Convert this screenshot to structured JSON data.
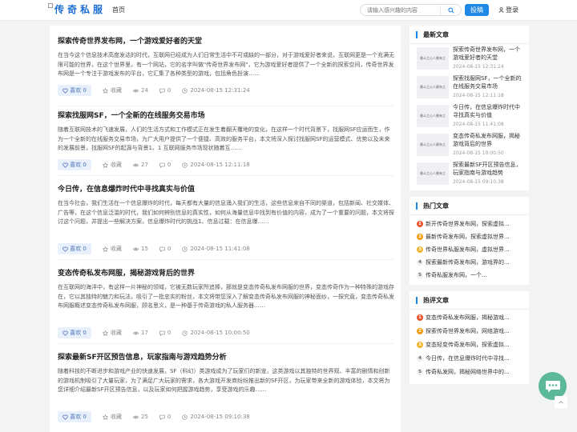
{
  "header": {
    "logo": "传奇私服",
    "nav_home": "首页",
    "search_placeholder": "请输入感兴趣的内容",
    "contribute": "投稿",
    "login": "登录"
  },
  "articles": [
    {
      "title": "探索传奇世界发布网，一个游戏爱好者的天堂",
      "summary": "在当今这个信息技术高度发达的时代，互联网已经成为人们日常生活中不可或缺的一部分，对于游戏爱好者来说，互联网更是一个充满无限可能的世界，在这个世界里，有一个网站，它的名字叫做\"传奇世界发布网\"，它为游戏爱好者提供了一个全新的探索空间，传奇世界发布网是一个专注于游戏发布的平台，它汇集了各种类型的游戏，包括角色扮演……",
      "like": "喜欢 0",
      "fav": "收藏",
      "views": "24",
      "comments": "0",
      "date": "2024-08-15 12:31:24"
    },
    {
      "title": "探索找服网SF，一个全新的在线服务交易市场",
      "summary": "随着互联网技术的飞速发展，人们的生活方式和工作模式正在发生着翻天覆地的变化，在这样一个时代背景下，找服网SF应运而生，作为一个全新的在线服务交易市场，为广大用户提供了一个便捷、高效的服务平台，本文将深入探讨找服网SF的运营模式、优势以及未来的发展前景，找服网SF的起源与背景1、1 互联网服务市场现状随着互……",
      "like": "喜欢 0",
      "fav": "收藏",
      "views": "27",
      "comments": "0",
      "date": "2024-08-15 12:11:18"
    },
    {
      "title": "今日传，在信息爆炸时代中寻找真实与价值",
      "summary": "在当今社会，我们生活在一个信息爆炸的时代，每天都有大量的信息涌入我们的生活，这些信息来自不同的渠道，包括新闻、社交媒体、广告等，在这个信息泛滥的时代，我们如何辨别信息的真实性，如何从海量信息中找到有价值的内容，成为了一个重要的问题，本文将探讨这个问题，并提出一些解决方案，信息爆炸时代的挑战1、信息过载：在信息爆……",
      "like": "喜欢 0",
      "fav": "收藏",
      "views": "15",
      "comments": "0",
      "date": "2024-08-15 11:41:08"
    },
    {
      "title": "变态传奇私发布网服，揭秘游戏背后的世界",
      "summary": "在互联网的海洋中，有这样一片神秘的领域，它被无数玩家所追捧，那就是变态传奇私发布网服的世界，变态传奇作为一种特殊的游戏存在，它以其独特的魅力和玩法，吸引了一批忠实的粉丝，本文将带您深入了解变态传奇私发布网服的神秘面纱，一探究竟，变态传奇私发布网服概述变态传奇私发布网服，顾名思义，是一种基于传奇游戏的私人服务器……",
      "like": "喜欢 0",
      "fav": "收藏",
      "views": "17",
      "comments": "0",
      "date": "2024-08-15 10:00:50"
    },
    {
      "title": "探索最新SF开区预告信息，玩家指南与游戏趋势分析",
      "summary": "随着科技的不断进步和游戏产业的快速发展，SF（科幻）类游戏成为了玩家们的新宠，这类游戏以其独特的世界观、丰富的剧情和创新的游戏机制吸引了大量玩家，为了满足广大玩家的需求，各大游戏开发商纷纷推出新的SF开区，为玩家带来全新的游戏体验，本文将为您详细介绍最新SF开区预告信息，以及玩家如何把握游戏趋势，享受游戏的乐趣……",
      "like": "喜欢 0",
      "fav": "收藏",
      "views": "25",
      "comments": "0",
      "date": "2024-08-15 09:10:38"
    }
  ],
  "sidebar": {
    "recent_title": "最新文章",
    "thumb_text": "最斗之心人最有之",
    "recent": [
      {
        "title": "探索传奇世界发布网，一个游戏爱好者的天堂",
        "date": "2024-08-15 12:31:24"
      },
      {
        "title": "探索找服网SF，一个全新的在线服务交易市场",
        "date": "2024-08-15 12:11:18"
      },
      {
        "title": "今日传，在信息爆炸时代中寻找真实与价值",
        "date": "2024-08-15 11:41:08"
      },
      {
        "title": "变态传奇私发布网服，揭秘游戏背后的世界",
        "date": "2024-08-15 10:00:50"
      },
      {
        "title": "探索最新SF开区预告信息，玩家指南与游戏趋势",
        "date": "2024-08-15 09:10:38"
      }
    ],
    "hot_title": "热门文章",
    "hot": [
      {
        "num": "1",
        "text": "新开传奇世界发布网，探索虚拟..."
      },
      {
        "num": "2",
        "text": "最新传奇发布网，探索虚拟世界..."
      },
      {
        "num": "3",
        "text": "传奇世界私服发布网，虚拟世界..."
      },
      {
        "num": "4",
        "text": "探索最新传奇发布网，游戏界的..."
      },
      {
        "num": "5",
        "text": "传奇私服发布网，一个..."
      }
    ],
    "review_title": "热评文章",
    "reviews": [
      {
        "num": "1",
        "text": "变态传奇私发布网服，揭秘游戏..."
      },
      {
        "num": "2",
        "text": "探索传奇世界发布网，网络游戏..."
      },
      {
        "num": "3",
        "text": "变态轻变传奇发布网，探索虚拟..."
      },
      {
        "num": "4",
        "text": "今日传，在信息爆炸时代中寻找..."
      },
      {
        "num": "5",
        "text": "传奇私发网，揭秘网络世界中的..."
      }
    ]
  },
  "colors": {
    "accent": "#1e88e5",
    "rank1": "#e8542b",
    "rank2": "#f39c12",
    "rank3": "#f0b429",
    "chat": "#5bb89a"
  }
}
